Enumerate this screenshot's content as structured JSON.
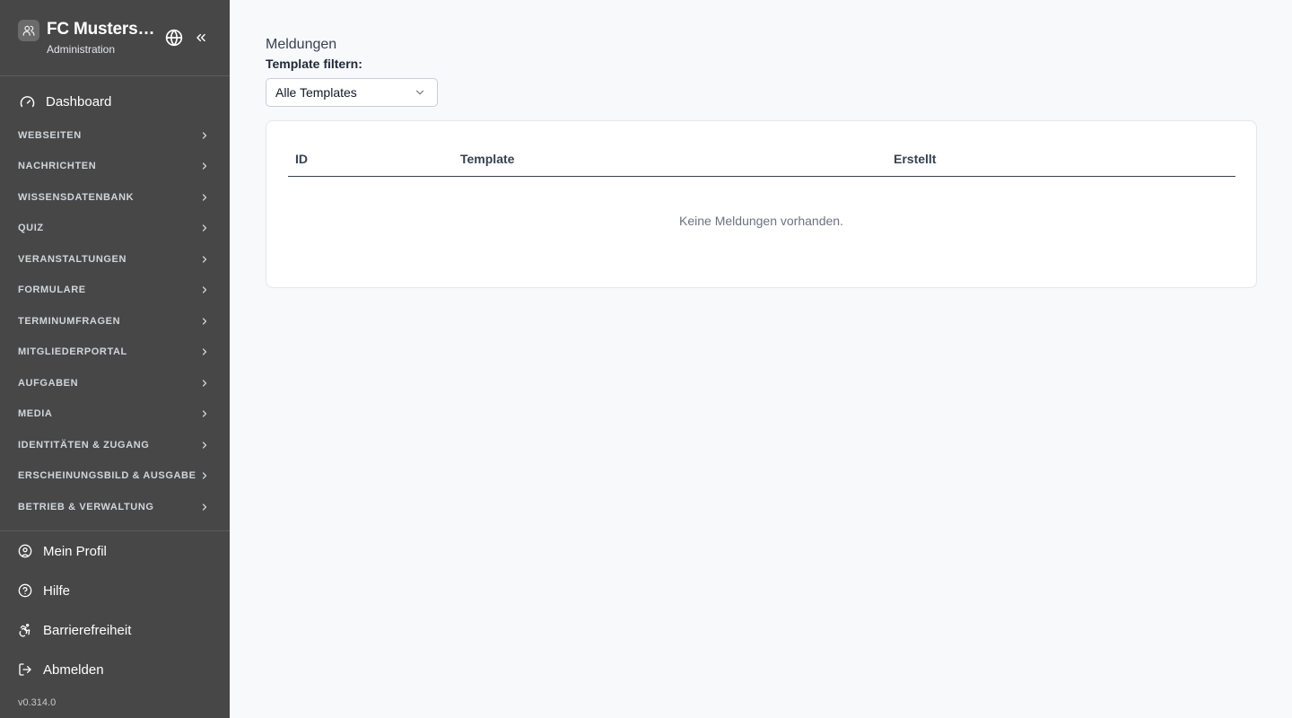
{
  "sidebar": {
    "org_name": "FC Musterstadt",
    "org_subtitle": "Administration",
    "dashboard_label": "Dashboard",
    "groups": [
      {
        "label": "WEBSEITEN"
      },
      {
        "label": "NACHRICHTEN"
      },
      {
        "label": "WISSENSDATENBANK"
      },
      {
        "label": "QUIZ"
      },
      {
        "label": "VERANSTALTUNGEN"
      },
      {
        "label": "FORMULARE"
      },
      {
        "label": "TERMINUMFRAGEN"
      },
      {
        "label": "MITGLIEDERPORTAL"
      },
      {
        "label": "AUFGABEN"
      },
      {
        "label": "MEDIA"
      },
      {
        "label": "IDENTITÄTEN & ZUGANG"
      },
      {
        "label": "ERSCHEINUNGSBILD & AUSGABE"
      },
      {
        "label": "BETRIEB & VERWALTUNG"
      }
    ],
    "bottom_items": [
      {
        "label": "Mein Profil",
        "icon": "user-circle-icon"
      },
      {
        "label": "Hilfe",
        "icon": "help-circle-icon"
      },
      {
        "label": "Barrierefreiheit",
        "icon": "accessibility-icon"
      },
      {
        "label": "Abmelden",
        "icon": "logout-icon"
      }
    ],
    "version": "v0.314.0"
  },
  "main": {
    "title": "Meldungen",
    "filter_label": "Template filtern:",
    "filter_selected": "Alle Templates",
    "table": {
      "columns": [
        "ID",
        "Template",
        "Erstellt"
      ],
      "rows": [],
      "empty_message": "Keine Meldungen vorhanden."
    }
  },
  "colors": {
    "sidebar_bg": "#474747",
    "main_bg": "#f8f9fb",
    "card_bg": "#ffffff"
  }
}
